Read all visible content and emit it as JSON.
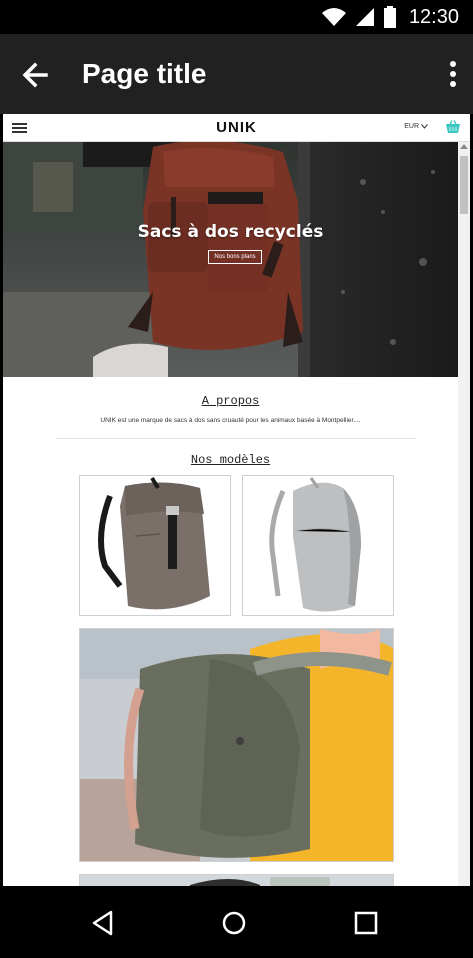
{
  "status_bar": {
    "time": "12:30"
  },
  "app_bar": {
    "title": "Page title"
  },
  "web": {
    "brand": "UNIK",
    "currency": "EUR",
    "hero": {
      "title": "Sacs à dos recyclés",
      "button": "Nos bons plans"
    },
    "about": {
      "title": "A propos",
      "text": "UNIK est une marque de sacs à dos sans cruauté pour les animaux basée à Montpellier...."
    },
    "models": {
      "title": "Nos modèles"
    }
  },
  "colors": {
    "app_bar": "#212121",
    "cart_accent": "#3cc7c4",
    "hero_bag": "#7a3426"
  },
  "icons": [
    "wifi-icon",
    "signal-icon",
    "battery-icon",
    "back-arrow-icon",
    "more-vert-icon",
    "menu-icon",
    "chevron-down-icon",
    "cart-icon",
    "nav-back-icon",
    "nav-home-icon",
    "nav-recent-icon"
  ]
}
